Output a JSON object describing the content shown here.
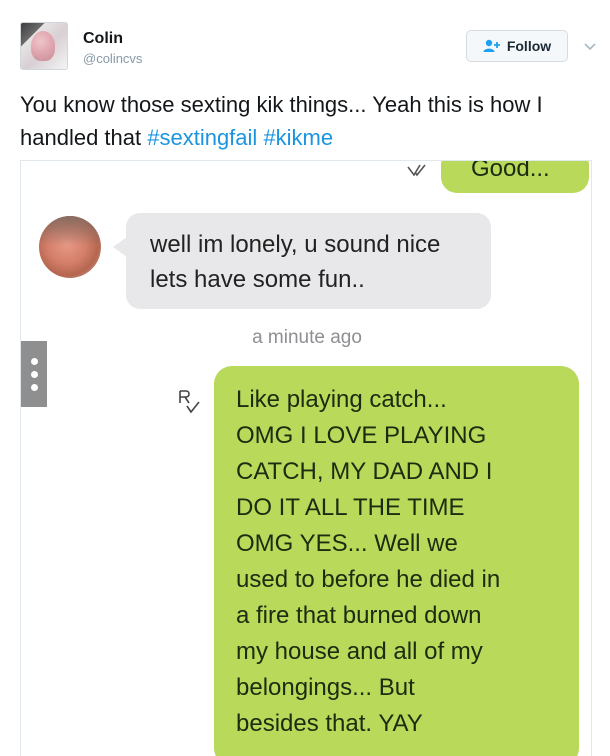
{
  "tweet": {
    "author": {
      "name": "Colin",
      "handle": "@colincvs"
    },
    "follow_label": "Follow",
    "text": "You know those sexting kik things... Yeah this is how I handled that",
    "hashtags": [
      "#sextingfail",
      "#kikme"
    ]
  },
  "chat": {
    "top_message_partial": "Good...",
    "incoming_message": "well im lonely, u sound nice lets have some fun..",
    "timestamp": "a minute ago",
    "outgoing_message_lines": [
      "Like playing catch...",
      "OMG I LOVE PLAYING",
      "CATCH, MY DAD AND I",
      "DO IT ALL THE TIME",
      "OMG YES... Well we",
      "used to before he died in",
      "a fire that burned down",
      "my house and all of my",
      "belongings... But",
      "besides that. YAY"
    ]
  },
  "icons": {
    "follow": "add-user-icon",
    "menu": "chevron-down-icon",
    "more": "more-dots-icon",
    "receipt": "read-receipt-icon"
  },
  "colors": {
    "hashtag": "#1b95e0",
    "outgoing_bubble": "#b8d95a",
    "incoming_bubble": "#e8e8ea"
  }
}
